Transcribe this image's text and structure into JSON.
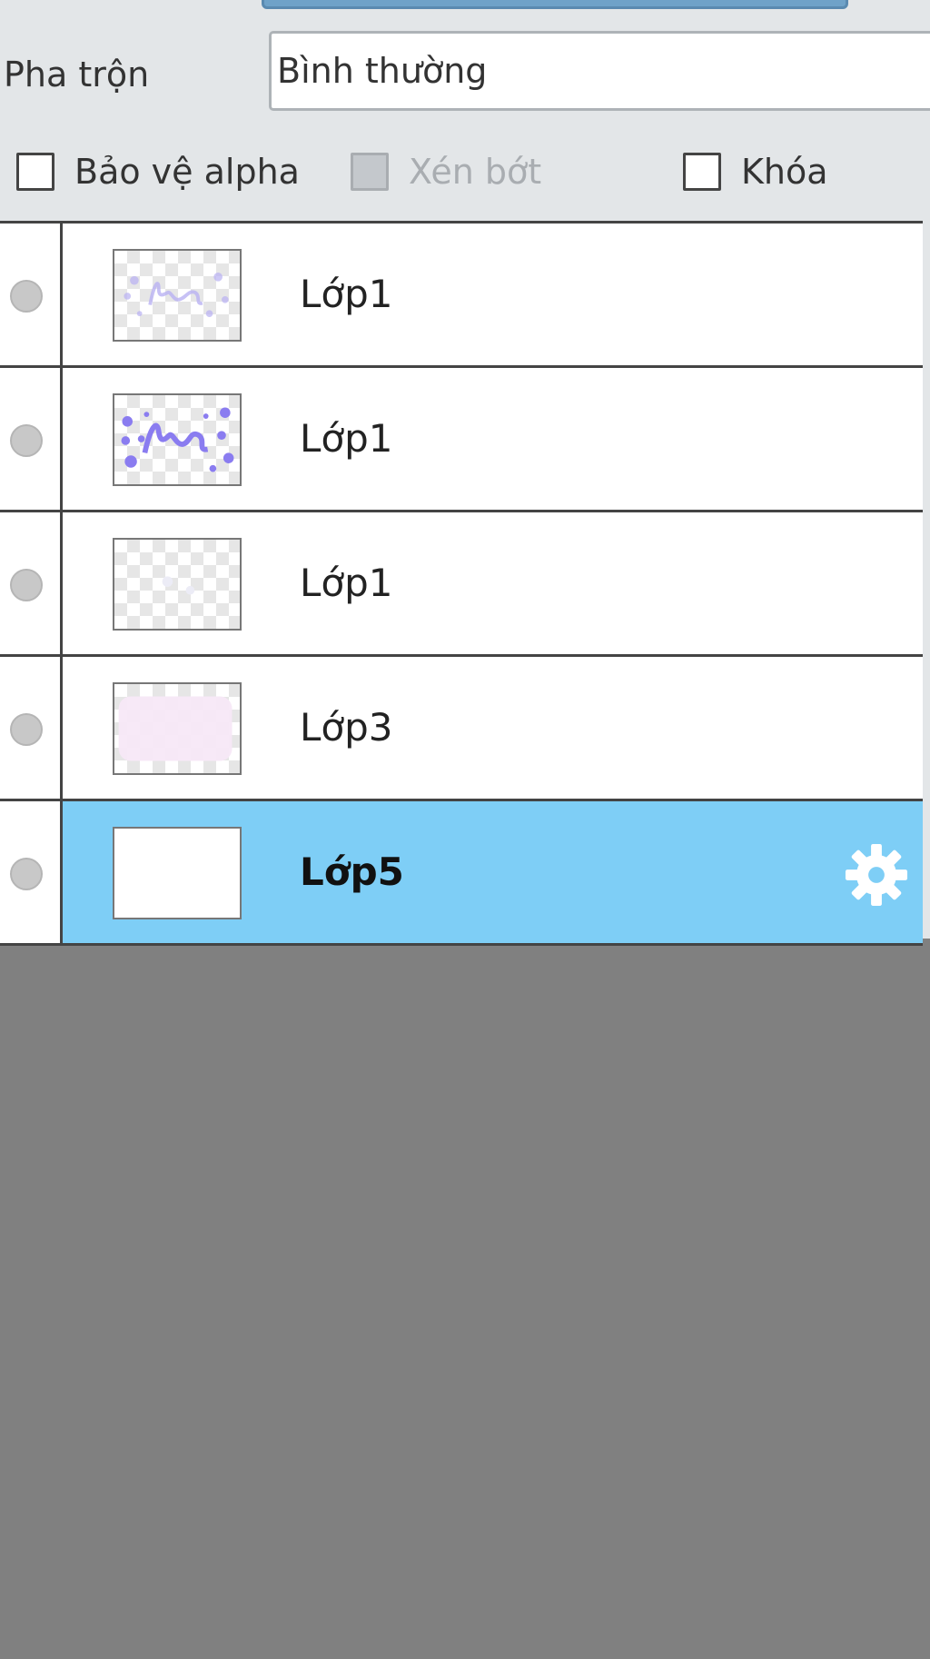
{
  "blend": {
    "label": "Pha trộn",
    "value": "Bình thường"
  },
  "options": {
    "protect_alpha": {
      "label": "Bảo vệ alpha",
      "checked": false
    },
    "clipping": {
      "label": "Xén bớt",
      "checked": false,
      "disabled": true
    },
    "lock": {
      "label": "Khóa",
      "checked": false
    }
  },
  "layers": [
    {
      "name": "Lớp1",
      "visible": false,
      "thumb": "light-lettering",
      "selected": false
    },
    {
      "name": "Lớp1",
      "visible": false,
      "thumb": "bold-lettering",
      "selected": false
    },
    {
      "name": "Lớp1",
      "visible": false,
      "thumb": "empty",
      "selected": false
    },
    {
      "name": "Lớp3",
      "visible": false,
      "thumb": "pink-fill",
      "selected": false
    },
    {
      "name": "Lớp5",
      "visible": false,
      "thumb": "white",
      "selected": true,
      "icon": "gear-icon"
    }
  ],
  "colors": {
    "selected_row": "#7ecef6",
    "panel_background": "#808080",
    "toolbar_background": "#e3e6e8",
    "thumbnail_lettering": "#8a7cf0",
    "thumbnail_pink": "#f7e8f7"
  }
}
